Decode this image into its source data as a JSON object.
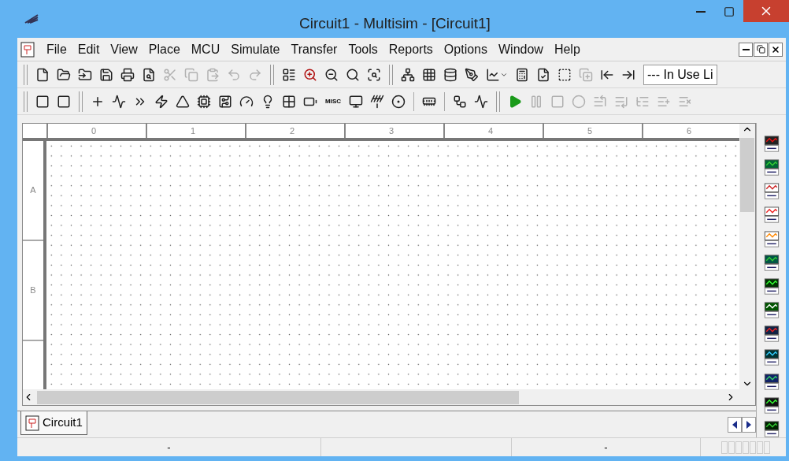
{
  "window": {
    "title": "Circuit1 - Multisim - [Circuit1]"
  },
  "menu": [
    {
      "label": "File"
    },
    {
      "label": "Edit"
    },
    {
      "label": "View"
    },
    {
      "label": "Place"
    },
    {
      "label": "MCU"
    },
    {
      "label": "Simulate"
    },
    {
      "label": "Transfer"
    },
    {
      "label": "Tools"
    },
    {
      "label": "Reports"
    },
    {
      "label": "Options"
    },
    {
      "label": "Window"
    },
    {
      "label": "Help"
    }
  ],
  "toolbar_main": [
    {
      "kind": "grip"
    },
    {
      "kind": "button",
      "disabled": false
    },
    {
      "kind": "button",
      "disabled": false
    },
    {
      "kind": "button",
      "disabled": false
    },
    {
      "kind": "button",
      "disabled": false
    },
    {
      "kind": "button",
      "disabled": false
    },
    {
      "kind": "button",
      "disabled": false
    },
    {
      "kind": "button",
      "disabled": true
    },
    {
      "kind": "button",
      "disabled": true
    },
    {
      "kind": "button",
      "disabled": true
    },
    {
      "kind": "button",
      "disabled": true
    },
    {
      "kind": "button",
      "disabled": true
    },
    {
      "kind": "grip"
    },
    {
      "kind": "button",
      "disabled": false
    },
    {
      "kind": "button",
      "disabled": false
    },
    {
      "kind": "button",
      "disabled": false
    },
    {
      "kind": "button",
      "disabled": false
    },
    {
      "kind": "button",
      "disabled": false
    },
    {
      "kind": "grip"
    },
    {
      "kind": "button",
      "disabled": false
    },
    {
      "kind": "button",
      "disabled": false
    },
    {
      "kind": "button",
      "disabled": false
    },
    {
      "kind": "button",
      "disabled": false
    },
    {
      "kind": "dropdown",
      "disabled": false
    },
    {
      "kind": "button",
      "disabled": false
    },
    {
      "kind": "button",
      "disabled": false
    },
    {
      "kind": "button",
      "disabled": false
    },
    {
      "kind": "button",
      "disabled": true
    },
    {
      "kind": "button",
      "disabled": false
    },
    {
      "kind": "button",
      "disabled": false
    },
    {
      "kind": "combo",
      "value": "--- In Use Li"
    }
  ],
  "toolbar_components": [
    {
      "kind": "grip"
    },
    {
      "kind": "button",
      "disabled": false
    },
    {
      "kind": "button",
      "disabled": false
    },
    {
      "kind": "grip"
    },
    {
      "kind": "button",
      "disabled": false
    },
    {
      "kind": "button",
      "disabled": false
    },
    {
      "kind": "button",
      "disabled": false
    },
    {
      "kind": "button",
      "disabled": false
    },
    {
      "kind": "button",
      "disabled": false
    },
    {
      "kind": "button",
      "disabled": false
    },
    {
      "kind": "button",
      "disabled": false
    },
    {
      "kind": "button",
      "disabled": false
    },
    {
      "kind": "button",
      "disabled": false
    },
    {
      "kind": "button",
      "disabled": false
    },
    {
      "kind": "button",
      "disabled": false
    },
    {
      "kind": "text",
      "label": "MISC"
    },
    {
      "kind": "button",
      "disabled": false
    },
    {
      "kind": "button",
      "disabled": false
    },
    {
      "kind": "button",
      "disabled": false
    },
    {
      "kind": "sep"
    },
    {
      "kind": "button",
      "disabled": false
    },
    {
      "kind": "sep"
    },
    {
      "kind": "button",
      "disabled": false
    },
    {
      "kind": "button",
      "disabled": false
    },
    {
      "kind": "grip"
    },
    {
      "kind": "button",
      "disabled": false
    },
    {
      "kind": "button",
      "disabled": true
    },
    {
      "kind": "button",
      "disabled": true
    },
    {
      "kind": "button",
      "disabled": true
    },
    {
      "kind": "button",
      "disabled": true
    },
    {
      "kind": "button",
      "disabled": true
    },
    {
      "kind": "button",
      "disabled": true
    },
    {
      "kind": "button",
      "disabled": true
    },
    {
      "kind": "button",
      "disabled": true
    }
  ],
  "ruler": {
    "columns": [
      "0",
      "1",
      "2",
      "3",
      "4",
      "5",
      "6"
    ],
    "rows": [
      "A",
      "B"
    ]
  },
  "tabs": [
    {
      "label": "Circuit1",
      "selected": true
    }
  ],
  "status_bar": [
    "-",
    "-"
  ]
}
